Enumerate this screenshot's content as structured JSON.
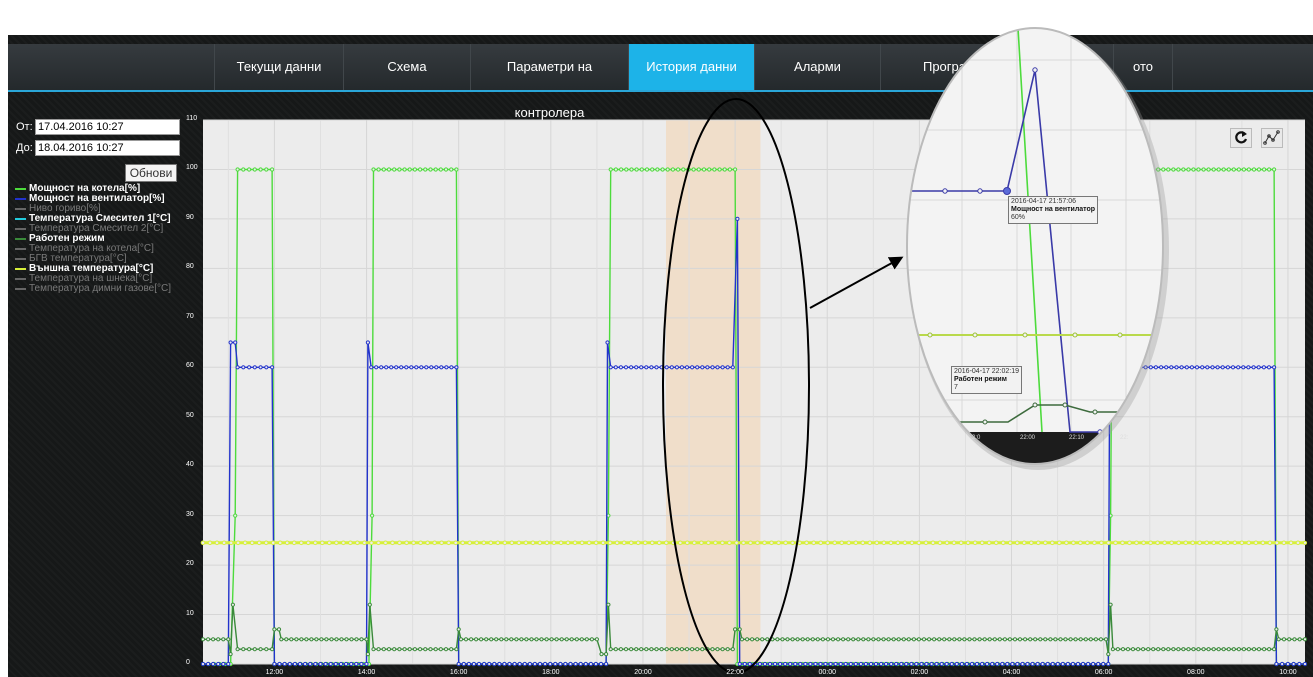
{
  "nav": {
    "items": [
      {
        "label": "Текущи данни",
        "active": false
      },
      {
        "label": "Схема",
        "active": false
      },
      {
        "label": "Параметри на контролера",
        "active": false
      },
      {
        "label": "История данни",
        "active": true
      },
      {
        "label": "Аларми",
        "active": false
      },
      {
        "label": "Програ",
        "active": false
      },
      {
        "label": "ото",
        "active": false
      }
    ]
  },
  "filter": {
    "from_label": "От:",
    "from_value": "17.04.2016 10:27",
    "to_label": "До:",
    "to_value": "18.04.2016 10:27",
    "refresh_label": "Обнови"
  },
  "legend": [
    {
      "label": "Мощност на котела[%]",
      "color": "#4ddb3c",
      "enabled": true
    },
    {
      "label": "Мощност на вентилатор[%]",
      "color": "#2233cc",
      "enabled": true
    },
    {
      "label": "Ниво гориво[%]",
      "color": "#666666",
      "enabled": false
    },
    {
      "label": "Температура Смесител 1[°C]",
      "color": "#22ccdd",
      "enabled": true
    },
    {
      "label": "Температура Смесител 2[°C]",
      "color": "#666666",
      "enabled": false
    },
    {
      "label": "Работен режим",
      "color": "#3a8a3a",
      "enabled": true
    },
    {
      "label": "Температура на котела[°C]",
      "color": "#666666",
      "enabled": false
    },
    {
      "label": "БГВ температура[°C]",
      "color": "#666666",
      "enabled": false
    },
    {
      "label": "Външна температура[°C]",
      "color": "#d7f03a",
      "enabled": true
    },
    {
      "label": "Температура на шнека[°C]",
      "color": "#666666",
      "enabled": false
    },
    {
      "label": "Температура димни газове[°C]",
      "color": "#666666",
      "enabled": false
    }
  ],
  "toolbar": {
    "refresh_icon": "refresh-icon",
    "line_icon": "line-chart-icon"
  },
  "zoom_tooltips": [
    {
      "time": "2016-04-17 21:57:06",
      "series": "Мощност на вентилатор",
      "value": "60%"
    },
    {
      "time": "2016-04-17 22:02:19",
      "series": "Работен режим",
      "value": "7"
    }
  ],
  "zoom_axis_labels": [
    "2:0",
    "22:00",
    "22:10",
    "22:"
  ],
  "chart_data": {
    "type": "line",
    "ylim": [
      0,
      110
    ],
    "y_ticks": [
      0,
      10,
      20,
      30,
      40,
      50,
      60,
      70,
      80,
      90,
      100,
      110
    ],
    "x_range_hours": [
      10.45,
      34.37
    ],
    "x_ticks": [
      {
        "h": 12,
        "label": "12:00"
      },
      {
        "h": 14,
        "label": "14:00"
      },
      {
        "h": 16,
        "label": "16:00"
      },
      {
        "h": 18,
        "label": "18:00"
      },
      {
        "h": 20,
        "label": "20:00"
      },
      {
        "h": 22,
        "label": "22:00"
      },
      {
        "h": 24,
        "label": "00:00"
      },
      {
        "h": 26,
        "label": "02:00"
      },
      {
        "h": 28,
        "label": "04:00"
      },
      {
        "h": 30,
        "label": "06:00"
      },
      {
        "h": 32,
        "label": "08:00"
      },
      {
        "h": 34,
        "label": "10:00"
      }
    ],
    "highlight_band_hours": [
      20.5,
      22.55
    ],
    "series": [
      {
        "name": "Мощност на котела[%]",
        "color": "#4ddb3c",
        "points": [
          [
            10.45,
            0
          ],
          [
            11.05,
            0
          ],
          [
            11.15,
            30
          ],
          [
            11.2,
            100
          ],
          [
            11.95,
            100
          ],
          [
            12.0,
            0
          ],
          [
            14.05,
            0
          ],
          [
            14.12,
            30
          ],
          [
            14.15,
            100
          ],
          [
            15.95,
            100
          ],
          [
            16.0,
            0
          ],
          [
            19.2,
            0
          ],
          [
            19.25,
            30
          ],
          [
            19.3,
            100
          ],
          [
            22.0,
            100
          ],
          [
            22.05,
            0
          ],
          [
            30.1,
            0
          ],
          [
            30.15,
            30
          ],
          [
            30.2,
            100
          ],
          [
            33.7,
            100
          ],
          [
            33.75,
            0
          ],
          [
            34.37,
            0
          ]
        ]
      },
      {
        "name": "Мощность на вентилатор[%]",
        "color": "#2233cc",
        "points": [
          [
            10.45,
            0
          ],
          [
            11.0,
            0
          ],
          [
            11.05,
            65
          ],
          [
            11.15,
            65
          ],
          [
            11.2,
            60
          ],
          [
            11.95,
            60
          ],
          [
            12.0,
            0
          ],
          [
            14.0,
            0
          ],
          [
            14.03,
            65
          ],
          [
            14.1,
            60
          ],
          [
            15.95,
            60
          ],
          [
            16.0,
            0
          ],
          [
            19.2,
            0
          ],
          [
            19.23,
            65
          ],
          [
            19.3,
            60
          ],
          [
            21.95,
            60
          ],
          [
            22.05,
            90
          ],
          [
            22.1,
            0
          ],
          [
            30.1,
            0
          ],
          [
            30.13,
            60
          ],
          [
            33.7,
            60
          ],
          [
            33.75,
            0
          ],
          [
            34.37,
            0
          ]
        ]
      },
      {
        "name": "Работен режим",
        "color": "#3a8a3a",
        "points": [
          [
            10.45,
            5
          ],
          [
            11.0,
            5
          ],
          [
            11.05,
            2
          ],
          [
            11.1,
            12
          ],
          [
            11.2,
            3
          ],
          [
            11.95,
            3
          ],
          [
            12.0,
            7
          ],
          [
            12.1,
            7
          ],
          [
            12.15,
            5
          ],
          [
            14.0,
            5
          ],
          [
            14.03,
            2
          ],
          [
            14.07,
            12
          ],
          [
            14.15,
            3
          ],
          [
            15.95,
            3
          ],
          [
            16.0,
            7
          ],
          [
            16.05,
            5
          ],
          [
            19.0,
            5
          ],
          [
            19.1,
            2
          ],
          [
            19.2,
            2
          ],
          [
            19.25,
            12
          ],
          [
            19.3,
            3
          ],
          [
            21.95,
            3
          ],
          [
            22.0,
            7
          ],
          [
            22.1,
            7
          ],
          [
            22.15,
            5
          ],
          [
            30.05,
            5
          ],
          [
            30.1,
            2
          ],
          [
            30.15,
            12
          ],
          [
            30.2,
            3
          ],
          [
            33.7,
            3
          ],
          [
            33.75,
            7
          ],
          [
            33.8,
            5
          ],
          [
            34.37,
            5
          ]
        ]
      },
      {
        "name": "Външна температура[°C]",
        "color": "#d7f03a",
        "points": [
          [
            10.45,
            24.5
          ],
          [
            34.37,
            24.5
          ]
        ]
      }
    ]
  }
}
